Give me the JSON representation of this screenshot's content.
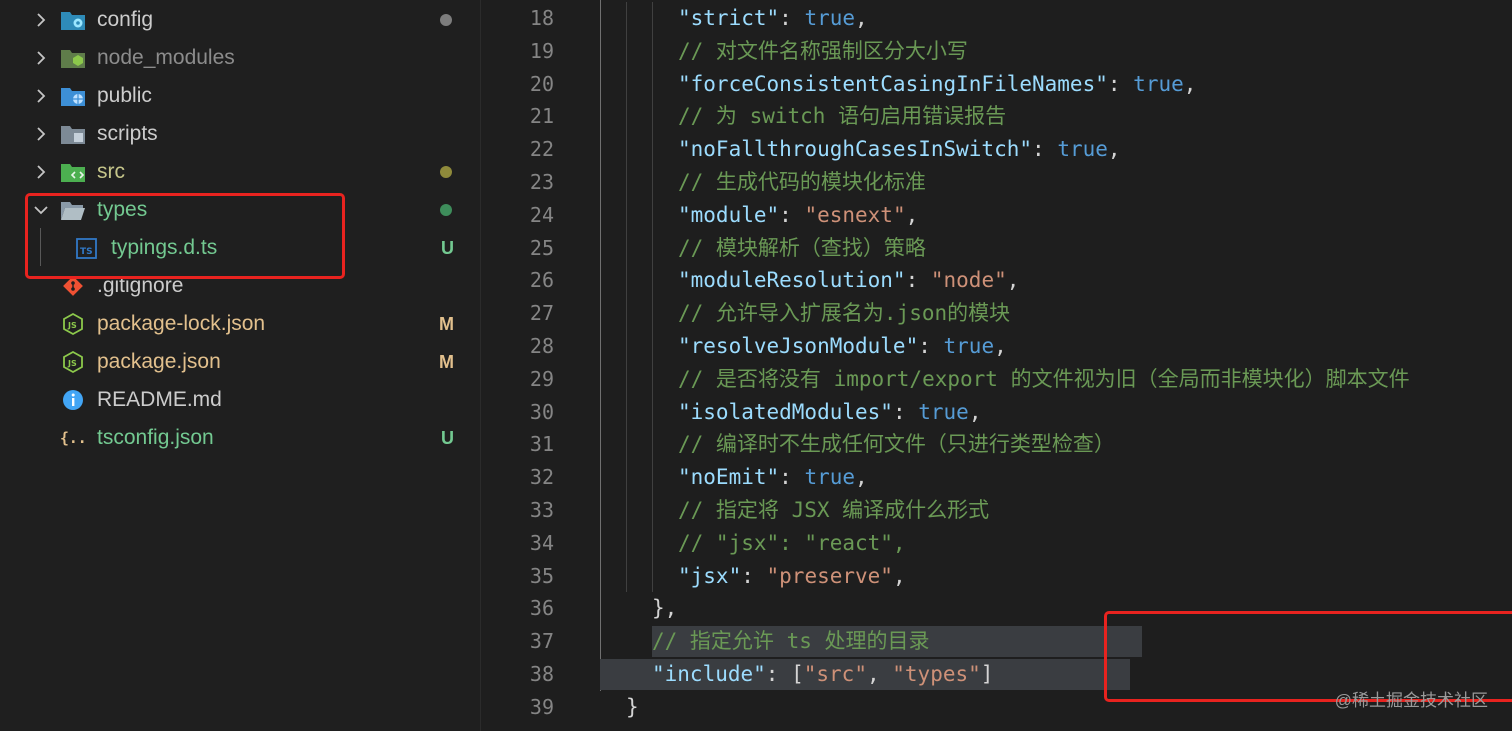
{
  "explorer": {
    "items": [
      {
        "label": "config",
        "kind": "folder",
        "icon": "config-folder-icon",
        "color": "#cccccc",
        "badge": "",
        "dot": "#7d7d7d",
        "expanded": false
      },
      {
        "label": "node_modules",
        "kind": "folder",
        "icon": "node-modules-folder-icon",
        "color": "#8c8c8c",
        "badge": "",
        "dot": "",
        "expanded": false
      },
      {
        "label": "public",
        "kind": "folder",
        "icon": "public-folder-icon",
        "color": "#cccccc",
        "badge": "",
        "dot": "",
        "expanded": false
      },
      {
        "label": "scripts",
        "kind": "folder",
        "icon": "scripts-folder-icon",
        "color": "#cccccc",
        "badge": "",
        "dot": "",
        "expanded": false
      },
      {
        "label": "src",
        "kind": "folder",
        "icon": "src-folder-icon",
        "color": "#c5c58a",
        "badge": "",
        "dot": "#8f8a3b",
        "expanded": false
      },
      {
        "label": "types",
        "kind": "folder",
        "icon": "folder-open-icon",
        "color": "#73c991",
        "badge": "",
        "dot": "#3e8d5b",
        "expanded": true
      },
      {
        "label": "typings.d.ts",
        "kind": "file",
        "icon": "typescript-icon",
        "color": "#73c991",
        "badge": "U",
        "badgeColor": "#73c991",
        "dot": ""
      },
      {
        "label": ".gitignore",
        "kind": "file",
        "icon": "git-icon",
        "color": "#cccccc",
        "badge": "",
        "dot": ""
      },
      {
        "label": "package-lock.json",
        "kind": "file",
        "icon": "nodejs-icon",
        "color": "#e2c08d",
        "badge": "M",
        "badgeColor": "#e2c08d",
        "dot": ""
      },
      {
        "label": "package.json",
        "kind": "file",
        "icon": "nodejs-icon",
        "color": "#e2c08d",
        "badge": "M",
        "badgeColor": "#e2c08d",
        "dot": ""
      },
      {
        "label": "README.md",
        "kind": "file",
        "icon": "info-icon",
        "color": "#cccccc",
        "badge": "",
        "dot": ""
      },
      {
        "label": "tsconfig.json",
        "kind": "file",
        "icon": "json-braces-icon",
        "color": "#73c991",
        "badge": "U",
        "badgeColor": "#73c991",
        "dot": ""
      }
    ]
  },
  "editor": {
    "lines": [
      {
        "n": "18",
        "indent": 3,
        "tokens": [
          [
            "key",
            "\"strict\""
          ],
          [
            "punc",
            ": "
          ],
          [
            "bool",
            "true"
          ],
          [
            "punc",
            ","
          ]
        ]
      },
      {
        "n": "19",
        "indent": 3,
        "tokens": [
          [
            "cmt",
            "// 对文件名称强制区分大小写"
          ]
        ]
      },
      {
        "n": "20",
        "indent": 3,
        "tokens": [
          [
            "key",
            "\"forceConsistentCasingInFileNames\""
          ],
          [
            "punc",
            ": "
          ],
          [
            "bool",
            "true"
          ],
          [
            "punc",
            ","
          ]
        ]
      },
      {
        "n": "21",
        "indent": 3,
        "tokens": [
          [
            "cmt",
            "// 为 switch 语句启用错误报告"
          ]
        ]
      },
      {
        "n": "22",
        "indent": 3,
        "tokens": [
          [
            "key",
            "\"noFallthroughCasesInSwitch\""
          ],
          [
            "punc",
            ": "
          ],
          [
            "bool",
            "true"
          ],
          [
            "punc",
            ","
          ]
        ]
      },
      {
        "n": "23",
        "indent": 3,
        "tokens": [
          [
            "cmt",
            "// 生成代码的模块化标准"
          ]
        ]
      },
      {
        "n": "24",
        "indent": 3,
        "tokens": [
          [
            "key",
            "\"module\""
          ],
          [
            "punc",
            ": "
          ],
          [
            "str",
            "\"esnext\""
          ],
          [
            "punc",
            ","
          ]
        ]
      },
      {
        "n": "25",
        "indent": 3,
        "tokens": [
          [
            "cmt",
            "// 模块解析（查找）策略"
          ]
        ]
      },
      {
        "n": "26",
        "indent": 3,
        "tokens": [
          [
            "key",
            "\"moduleResolution\""
          ],
          [
            "punc",
            ": "
          ],
          [
            "str",
            "\"node\""
          ],
          [
            "punc",
            ","
          ]
        ]
      },
      {
        "n": "27",
        "indent": 3,
        "tokens": [
          [
            "cmt",
            "// 允许导入扩展名为.json的模块"
          ]
        ]
      },
      {
        "n": "28",
        "indent": 3,
        "tokens": [
          [
            "key",
            "\"resolveJsonModule\""
          ],
          [
            "punc",
            ": "
          ],
          [
            "bool",
            "true"
          ],
          [
            "punc",
            ","
          ]
        ]
      },
      {
        "n": "29",
        "indent": 3,
        "tokens": [
          [
            "cmt",
            "// 是否将没有 import/export 的文件视为旧（全局而非模块化）脚本文件"
          ]
        ]
      },
      {
        "n": "30",
        "indent": 3,
        "tokens": [
          [
            "key",
            "\"isolatedModules\""
          ],
          [
            "punc",
            ": "
          ],
          [
            "bool",
            "true"
          ],
          [
            "punc",
            ","
          ]
        ]
      },
      {
        "n": "31",
        "indent": 3,
        "tokens": [
          [
            "cmt",
            "// 编译时不生成任何文件（只进行类型检查）"
          ]
        ]
      },
      {
        "n": "32",
        "indent": 3,
        "tokens": [
          [
            "key",
            "\"noEmit\""
          ],
          [
            "punc",
            ": "
          ],
          [
            "bool",
            "true"
          ],
          [
            "punc",
            ","
          ]
        ]
      },
      {
        "n": "33",
        "indent": 3,
        "tokens": [
          [
            "cmt",
            "// 指定将 JSX 编译成什么形式"
          ]
        ]
      },
      {
        "n": "34",
        "indent": 3,
        "tokens": [
          [
            "cmt",
            "// \"jsx\": \"react\","
          ]
        ]
      },
      {
        "n": "35",
        "indent": 3,
        "tokens": [
          [
            "key",
            "\"jsx\""
          ],
          [
            "punc",
            ": "
          ],
          [
            "str",
            "\"preserve\""
          ],
          [
            "punc",
            ","
          ]
        ]
      },
      {
        "n": "36",
        "indent": 2,
        "tokens": [
          [
            "punc",
            "},"
          ]
        ]
      },
      {
        "n": "37",
        "indent": 2,
        "tokens": [
          [
            "cmt",
            "// 指定允许 ts 处理的目录"
          ]
        ]
      },
      {
        "n": "38",
        "indent": 2,
        "tokens": [
          [
            "key",
            "\"include\""
          ],
          [
            "punc",
            ": "
          ],
          [
            "punc",
            "["
          ],
          [
            "str",
            "\"src\""
          ],
          [
            "punc",
            ", "
          ],
          [
            "str",
            "\"types\""
          ],
          [
            "punc",
            "]"
          ]
        ]
      },
      {
        "n": "39",
        "indent": 1,
        "tokens": [
          [
            "punc",
            "}"
          ]
        ]
      }
    ]
  },
  "watermark": "@稀土掘金技术社区",
  "colors": {
    "annotation": "#e8231f",
    "untracked": "#73c991",
    "modified": "#e2c08d"
  }
}
